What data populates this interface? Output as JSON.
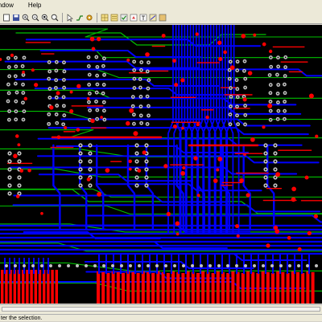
{
  "menu": {
    "items": [
      "indow",
      "Help"
    ]
  },
  "toolbar": {
    "buttons": [
      "new-icon",
      "save-icon",
      "zoom-in-icon",
      "zoom-out-icon",
      "zoom-fit-icon",
      "zoom-area-icon",
      "select-icon",
      "route-icon",
      "via-icon",
      "grid-icon",
      "layers-icon",
      "drc-icon",
      "net-icon",
      "text-icon",
      "measure-icon",
      "snap-icon"
    ]
  },
  "status": {
    "text": "ter the selection."
  },
  "colors": {
    "background": "#000000",
    "top_layer": "#ff0000",
    "bottom_layer": "#0000ff",
    "inner_layer": "#00c000",
    "pad": "#c0c0c0"
  }
}
